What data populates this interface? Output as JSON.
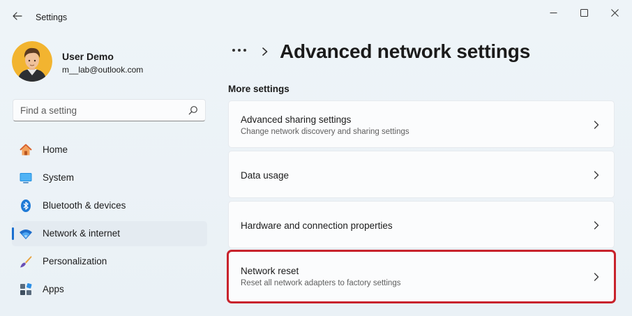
{
  "window": {
    "app_title": "Settings",
    "controls": {
      "minimize": "minimize-icon",
      "maximize": "maximize-icon",
      "close": "close-icon"
    }
  },
  "user": {
    "name": "User Demo",
    "email": "m__lab@outlook.com"
  },
  "search": {
    "placeholder": "Find a setting",
    "value": ""
  },
  "sidebar": {
    "items": [
      {
        "label": "Home",
        "icon": "home-icon",
        "active": false
      },
      {
        "label": "System",
        "icon": "system-icon",
        "active": false
      },
      {
        "label": "Bluetooth & devices",
        "icon": "bluetooth-icon",
        "active": false
      },
      {
        "label": "Network & internet",
        "icon": "wifi-icon",
        "active": true
      },
      {
        "label": "Personalization",
        "icon": "brush-icon",
        "active": false
      },
      {
        "label": "Apps",
        "icon": "apps-icon",
        "active": false
      }
    ]
  },
  "main": {
    "breadcrumb_more": "...",
    "page_title": "Advanced network settings",
    "section_title": "More settings",
    "cards": [
      {
        "title": "Advanced sharing settings",
        "subtitle": "Change network discovery and sharing settings"
      },
      {
        "title": "Data usage",
        "subtitle": ""
      },
      {
        "title": "Hardware and connection properties",
        "subtitle": ""
      },
      {
        "title": "Network reset",
        "subtitle": "Reset all network adapters to factory settings",
        "highlighted": true
      }
    ]
  },
  "colors": {
    "accent": "#1a6fcf",
    "highlight_border": "#c8232c",
    "background": "#eef3f7",
    "card": "#fbfcfd"
  }
}
